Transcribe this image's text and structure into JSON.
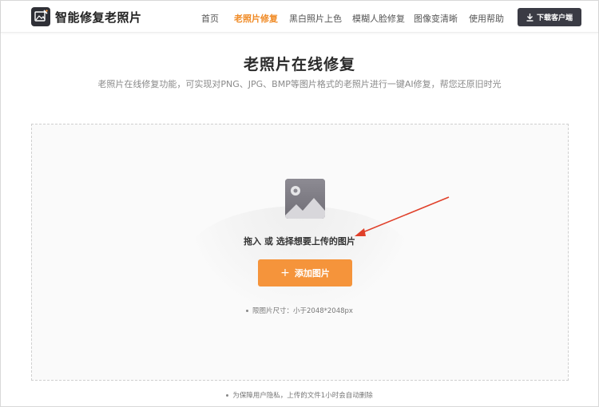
{
  "header": {
    "brand": "智能修复老照片",
    "logo_icon": "photo-magic-icon",
    "nav": [
      {
        "label": "首页",
        "active": false
      },
      {
        "label": "老照片修复",
        "active": true
      },
      {
        "label": "黑白照片上色",
        "active": false
      },
      {
        "label": "模糊人脸修复",
        "active": false
      },
      {
        "label": "图像变清晰",
        "active": false
      },
      {
        "label": "使用帮助",
        "active": false
      }
    ],
    "download_label": "下载客户端",
    "download_icon": "download-icon"
  },
  "main": {
    "title": "老照片在线修复",
    "subtitle": "老照片在线修复功能，可实现对PNG、JPG、BMP等图片格式的老照片进行一键AI修复，帮您还原旧时光"
  },
  "upload": {
    "image_icon": "image-placeholder-icon",
    "prompt": "拖入 或 选择想要上传的图片",
    "add_label": "添加图片",
    "limit_text": "限图片尺寸：小于2048*2048px"
  },
  "footer": {
    "privacy_text": "为保障用户隐私，上传的文件1小时会自动删除"
  },
  "colors": {
    "accent": "#f5943b",
    "nav_active": "#f08a24",
    "dark_button": "#3a3b44",
    "annotation_arrow": "#e0402a"
  }
}
